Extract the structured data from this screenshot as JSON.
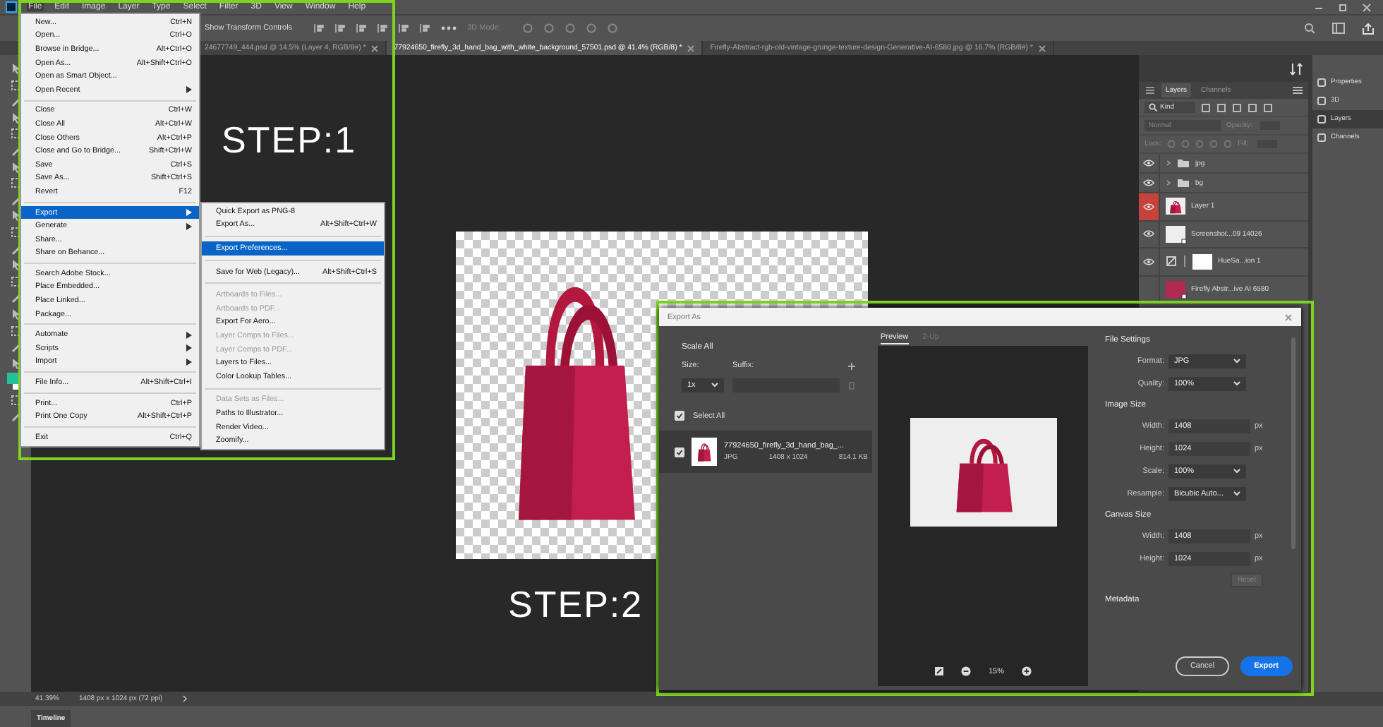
{
  "menu_bar": {
    "items": [
      {
        "label": "File",
        "selected": true
      },
      {
        "label": "Edit",
        "selected": false
      },
      {
        "label": "Image",
        "selected": false
      },
      {
        "label": "Layer",
        "selected": false
      },
      {
        "label": "Type",
        "selected": false
      },
      {
        "label": "Select",
        "selected": false
      },
      {
        "label": "Filter",
        "selected": false
      },
      {
        "label": "3D",
        "selected": false
      },
      {
        "label": "View",
        "selected": false
      },
      {
        "label": "Window",
        "selected": false
      },
      {
        "label": "Help",
        "selected": false
      }
    ]
  },
  "options_bar": {
    "transform_label": "Show Transform Controls",
    "mode_label": "3D Mode:"
  },
  "tabs": [
    {
      "label": "24677749_444.psd @ 14.5% (Layer 4, RGB/8#) *",
      "selected": false
    },
    {
      "label": "77924650_firefly_3d_hand_bag_with_white_background_57501.psd @ 41.4% (RGB/8) *",
      "selected": true
    },
    {
      "label": "Firefly-Abstract-rgb-old-vintage-grunge-texture-design-Generative-AI-6580.jpg @ 16.7% (RGB/8#) *",
      "selected": false
    }
  ],
  "file_menu": {
    "groups": [
      [
        {
          "label": "New...",
          "shortcut": "Ctrl+N",
          "submenu": false,
          "selected": false,
          "disabled": false
        },
        {
          "label": "Open...",
          "shortcut": "Ctrl+O",
          "submenu": false,
          "selected": false,
          "disabled": false
        },
        {
          "label": "Browse in Bridge...",
          "shortcut": "Alt+Ctrl+O",
          "submenu": false,
          "selected": false,
          "disabled": false
        },
        {
          "label": "Open As...",
          "shortcut": "Alt+Shift+Ctrl+O",
          "submenu": false,
          "selected": false,
          "disabled": false
        },
        {
          "label": "Open as Smart Object...",
          "submenu": false,
          "selected": false,
          "disabled": false
        },
        {
          "label": "Open Recent",
          "submenu": true,
          "selected": false,
          "disabled": false
        }
      ],
      [
        {
          "label": "Close",
          "shortcut": "Ctrl+W",
          "submenu": false,
          "selected": false,
          "disabled": false
        },
        {
          "label": "Close All",
          "shortcut": "Alt+Ctrl+W",
          "submenu": false,
          "selected": false,
          "disabled": false
        },
        {
          "label": "Close Others",
          "shortcut": "Alt+Ctrl+P",
          "submenu": false,
          "selected": false,
          "disabled": false
        },
        {
          "label": "Close and Go to Bridge...",
          "shortcut": "Shift+Ctrl+W",
          "submenu": false,
          "selected": false,
          "disabled": false
        },
        {
          "label": "Save",
          "shortcut": "Ctrl+S",
          "submenu": false,
          "selected": false,
          "disabled": false
        },
        {
          "label": "Save As...",
          "shortcut": "Shift+Ctrl+S",
          "submenu": false,
          "selected": false,
          "disabled": false
        },
        {
          "label": "Revert",
          "shortcut": "F12",
          "submenu": false,
          "selected": false,
          "disabled": false
        }
      ],
      [
        {
          "label": "Export",
          "submenu": true,
          "selected": true,
          "disabled": false
        },
        {
          "label": "Generate",
          "submenu": true,
          "selected": false,
          "disabled": false
        },
        {
          "label": "Share...",
          "submenu": false,
          "selected": false,
          "disabled": false
        },
        {
          "label": "Share on Behance...",
          "submenu": false,
          "selected": false,
          "disabled": false
        }
      ],
      [
        {
          "label": "Search Adobe Stock...",
          "submenu": false,
          "selected": false,
          "disabled": false
        },
        {
          "label": "Place Embedded...",
          "submenu": false,
          "selected": false,
          "disabled": false
        },
        {
          "label": "Place Linked...",
          "submenu": false,
          "selected": false,
          "disabled": false
        },
        {
          "label": "Package...",
          "submenu": false,
          "selected": false,
          "disabled": false
        }
      ],
      [
        {
          "label": "Automate",
          "submenu": true,
          "selected": false,
          "disabled": false
        },
        {
          "label": "Scripts",
          "submenu": true,
          "selected": false,
          "disabled": false
        },
        {
          "label": "Import",
          "submenu": true,
          "selected": false,
          "disabled": false
        }
      ],
      [
        {
          "label": "File Info...",
          "shortcut": "Alt+Shift+Ctrl+I",
          "submenu": false,
          "selected": false,
          "disabled": false
        }
      ],
      [
        {
          "label": "Print...",
          "shortcut": "Ctrl+P",
          "submenu": false,
          "selected": false,
          "disabled": false
        },
        {
          "label": "Print One Copy",
          "shortcut": "Alt+Shift+Ctrl+P",
          "submenu": false,
          "selected": false,
          "disabled": false
        }
      ],
      [
        {
          "label": "Exit",
          "shortcut": "Ctrl+Q",
          "submenu": false,
          "selected": false,
          "disabled": false
        }
      ]
    ]
  },
  "export_submenu": {
    "groups": [
      [
        {
          "label": "Quick Export as PNG-8",
          "submenu": false,
          "selected": false,
          "disabled": false
        },
        {
          "label": "Export As...",
          "shortcut": "Alt+Shift+Ctrl+W",
          "submenu": false,
          "selected": false,
          "disabled": false
        }
      ],
      [
        {
          "label": "Export Preferences...",
          "submenu": false,
          "selected": true,
          "disabled": false
        }
      ],
      [
        {
          "label": "Save for Web (Legacy)...",
          "shortcut": "Alt+Shift+Ctrl+S",
          "submenu": false,
          "selected": false,
          "disabled": false
        }
      ],
      [
        {
          "label": "Artboards to Files...",
          "submenu": false,
          "selected": false,
          "disabled": true
        },
        {
          "label": "Artboards to PDF...",
          "submenu": false,
          "selected": false,
          "disabled": true
        },
        {
          "label": "Export For Aero...",
          "submenu": false,
          "selected": false,
          "disabled": false
        },
        {
          "label": "Layer Comps to Files...",
          "submenu": false,
          "selected": false,
          "disabled": true
        },
        {
          "label": "Layer Comps to PDF...",
          "submenu": false,
          "selected": false,
          "disabled": true
        },
        {
          "label": "Layers to Files...",
          "submenu": false,
          "selected": false,
          "disabled": false
        },
        {
          "label": "Color Lookup Tables...",
          "submenu": false,
          "selected": false,
          "disabled": false
        }
      ],
      [
        {
          "label": "Data Sets as Files...",
          "submenu": false,
          "selected": false,
          "disabled": true
        },
        {
          "label": "Paths to Illustrator...",
          "submenu": false,
          "selected": false,
          "disabled": false
        },
        {
          "label": "Render Video...",
          "submenu": false,
          "selected": false,
          "disabled": false
        },
        {
          "label": "Zoomify...",
          "submenu": false,
          "selected": false,
          "disabled": false
        }
      ]
    ]
  },
  "step_labels": [
    "STEP:1",
    "STEP:2"
  ],
  "layers_panel": {
    "tabs": [
      {
        "label": "Layers",
        "selected": true
      },
      {
        "label": "Channels",
        "selected": false
      }
    ],
    "filter": "Kind",
    "blend_mode": "Normal",
    "opacity_label": "Opacity:",
    "lock_label": "Lock:",
    "fill_label": "Fill:",
    "layers": [
      {
        "name": "jpg",
        "kind": "group",
        "visible": true,
        "selected": false
      },
      {
        "name": "bg",
        "kind": "group",
        "visible": true,
        "selected": false
      },
      {
        "name": "Layer 1",
        "kind": "pixel",
        "visible": true,
        "selected": true
      },
      {
        "name": "Screenshot...09 14026",
        "kind": "smart",
        "visible": true,
        "selected": false
      },
      {
        "name": "HueSa...ion 1",
        "kind": "adjustment",
        "visible": true,
        "selected": false
      },
      {
        "name": "Firefly Abstr...ive AI 6580",
        "kind": "smart",
        "visible": false,
        "selected": false
      }
    ]
  },
  "dock": [
    {
      "label": "Properties",
      "selected": false
    },
    {
      "label": "3D",
      "selected": false
    },
    {
      "label": "Layers",
      "selected": true
    },
    {
      "label": "Channels",
      "selected": false
    }
  ],
  "export_dialog": {
    "title": "Export As",
    "scale_title": "Scale All",
    "size_label": "Size:",
    "suffix_label": "Suffix:",
    "size_value": "1x",
    "select_all": {
      "label": "Select All",
      "checked": true
    },
    "file": {
      "name": "77924650_firefly_3d_hand_bag_...",
      "format": "JPG",
      "dimensions": "1408 x 1024",
      "size": "814.1 KB",
      "checked": true
    },
    "preview_tabs": [
      {
        "label": "Preview",
        "selected": true
      },
      {
        "label": "2-Up",
        "selected": false
      }
    ],
    "zoom": "15%",
    "sections": [
      {
        "title": "File Settings",
        "fields": [
          {
            "label": "Format:",
            "value": "JPG",
            "kind": "select"
          },
          {
            "label": "Quality:",
            "value": "100%",
            "kind": "select"
          }
        ]
      },
      {
        "title": "Image Size",
        "fields": [
          {
            "label": "Width:",
            "value": "1408",
            "unit": "px",
            "kind": "input"
          },
          {
            "label": "Height:",
            "value": "1024",
            "unit": "px",
            "kind": "input"
          },
          {
            "label": "Scale:",
            "value": "100%",
            "kind": "select"
          },
          {
            "label": "Resample:",
            "value": "Bicubic Auto...",
            "kind": "select"
          }
        ]
      },
      {
        "title": "Canvas Size",
        "fields": [
          {
            "label": "Width:",
            "value": "1408",
            "unit": "px",
            "kind": "input"
          },
          {
            "label": "Height:",
            "value": "1024",
            "unit": "px",
            "kind": "input"
          }
        ],
        "reset": "Reset"
      },
      {
        "title": "Metadata"
      }
    ],
    "cancel": "Cancel",
    "export": "Export"
  },
  "status_bar": {
    "zoom": "41.39%",
    "doc_info": "1408 px x 1024 px (72 ppi)"
  },
  "timeline": "Timeline"
}
